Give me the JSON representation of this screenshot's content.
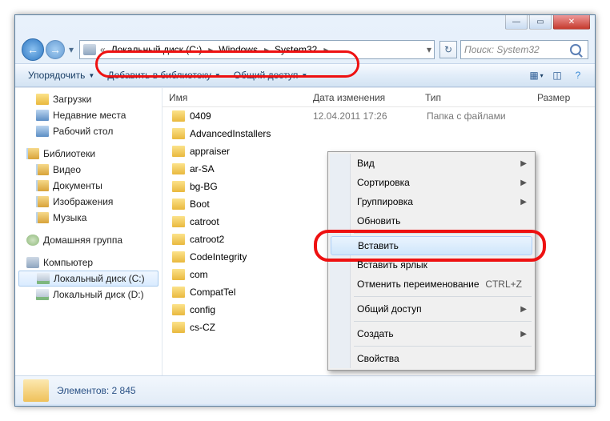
{
  "titlebar": {
    "minimize": "—",
    "maximize": "▭",
    "close": "✕"
  },
  "breadcrumbs": {
    "root_icon": "computer",
    "nav_overflow": "«",
    "items": [
      "Локальный диск (C:)",
      "Windows",
      "System32"
    ]
  },
  "search": {
    "placeholder": "Поиск: System32"
  },
  "toolbar": {
    "organize": "Упорядочить",
    "add_library": "Добавить в библиотеку",
    "share": "Общий доступ"
  },
  "sidebar": {
    "favorites": [
      {
        "label": "Загрузки",
        "icon": "ico-folder"
      },
      {
        "label": "Недавние места",
        "icon": "ico-blue"
      },
      {
        "label": "Рабочий стол",
        "icon": "ico-desktop"
      }
    ],
    "libraries_header": "Библиотеки",
    "libraries": [
      {
        "label": "Видео",
        "icon": "ico-lib"
      },
      {
        "label": "Документы",
        "icon": "ico-lib"
      },
      {
        "label": "Изображения",
        "icon": "ico-lib"
      },
      {
        "label": "Музыка",
        "icon": "ico-lib"
      }
    ],
    "homegroup": "Домашняя группа",
    "computer": "Компьютер",
    "drives": [
      {
        "label": "Локальный диск (C:)",
        "selected": true
      },
      {
        "label": "Локальный диск (D:)",
        "selected": false
      }
    ]
  },
  "columns": {
    "name": "Имя",
    "date": "Дата изменения",
    "type": "Тип",
    "size": "Размер"
  },
  "first_row_meta": {
    "date": "12.04.2011 17:26",
    "type": "Папка с файлами"
  },
  "files": [
    "0409",
    "AdvancedInstallers",
    "appraiser",
    "ar-SA",
    "bg-BG",
    "Boot",
    "catroot",
    "catroot2",
    "CodeIntegrity",
    "com",
    "CompatTel",
    "config",
    "cs-CZ"
  ],
  "context_menu": {
    "view": "Вид",
    "sort": "Сортировка",
    "group": "Группировка",
    "refresh": "Обновить",
    "paste": "Вставить",
    "paste_shortcut": "Вставить ярлык",
    "undo_rename": "Отменить переименование",
    "undo_shortcut": "CTRL+Z",
    "share": "Общий доступ",
    "new": "Создать",
    "properties": "Свойства"
  },
  "status": {
    "text": "Элементов: 2 845"
  }
}
